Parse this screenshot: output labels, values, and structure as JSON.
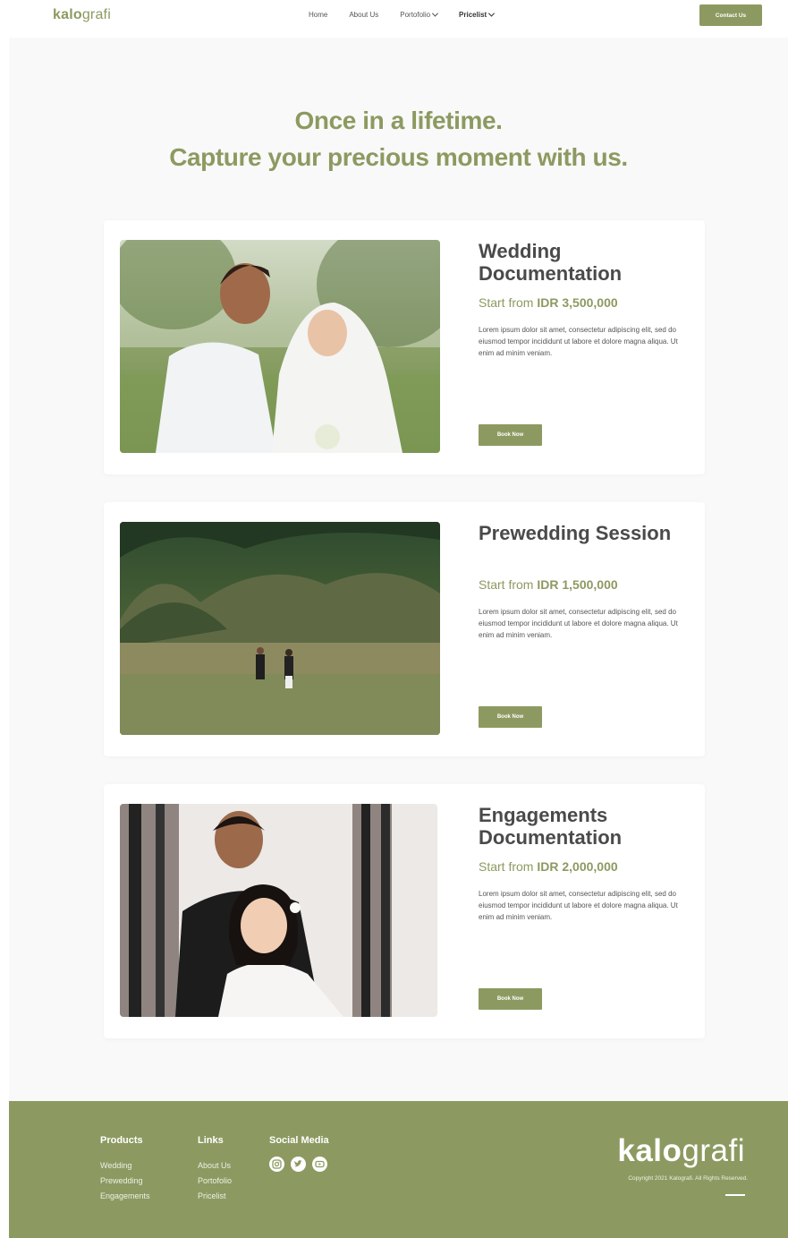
{
  "nav": {
    "logo_bold": "kalo",
    "logo_light": "grafi",
    "links": [
      {
        "label": "Home"
      },
      {
        "label": "About Us"
      },
      {
        "label": "Portofolio"
      },
      {
        "label": "Pricelist"
      }
    ],
    "contact_label": "Contact Us"
  },
  "hero": {
    "line1": "Once in a lifetime.",
    "line2": "Capture your precious moment with us."
  },
  "packages": [
    {
      "title": "Wedding Documentation",
      "price_prefix": "Start from",
      "price": "IDR 3,500,000",
      "description": "Lorem ipsum dolor sit amet, consectetur adipiscing elit, sed do eiusmod tempor incididunt ut labore et dolore magna aliqua. Ut enim ad minim veniam.",
      "button": "Book Now"
    },
    {
      "title": "Prewedding Session",
      "price_prefix": "Start from",
      "price": "IDR 1,500,000",
      "description": "Lorem ipsum dolor sit amet, consectetur adipiscing elit, sed do eiusmod tempor incididunt ut labore et dolore magna aliqua. Ut enim ad minim veniam.",
      "button": "Book Now"
    },
    {
      "title": "Engagements Documentation",
      "price_prefix": "Start from",
      "price": "IDR 2,000,000",
      "description": "Lorem ipsum dolor sit amet, consectetur adipiscing elit, sed do eiusmod tempor incididunt ut labore et dolore magna aliqua. Ut enim ad minim veniam.",
      "button": "Book Now"
    }
  ],
  "footer": {
    "products_title": "Products",
    "products": [
      "Wedding",
      "Prewedding",
      "Engagements"
    ],
    "links_title": "Links",
    "links": [
      "About Us",
      "Portofolio",
      "Pricelist"
    ],
    "social_title": "Social Media",
    "social_icons": [
      "instagram-icon",
      "twitter-icon",
      "youtube-icon"
    ],
    "logo_bold": "kalo",
    "logo_light": "grafi",
    "copyright": "Copyright 2021 Kalografi. All Rights Reserved."
  },
  "colors": {
    "accent": "#8c9a61",
    "background": "#f9f9f9",
    "card": "#ffffff",
    "heading": "#4a4a4a"
  }
}
